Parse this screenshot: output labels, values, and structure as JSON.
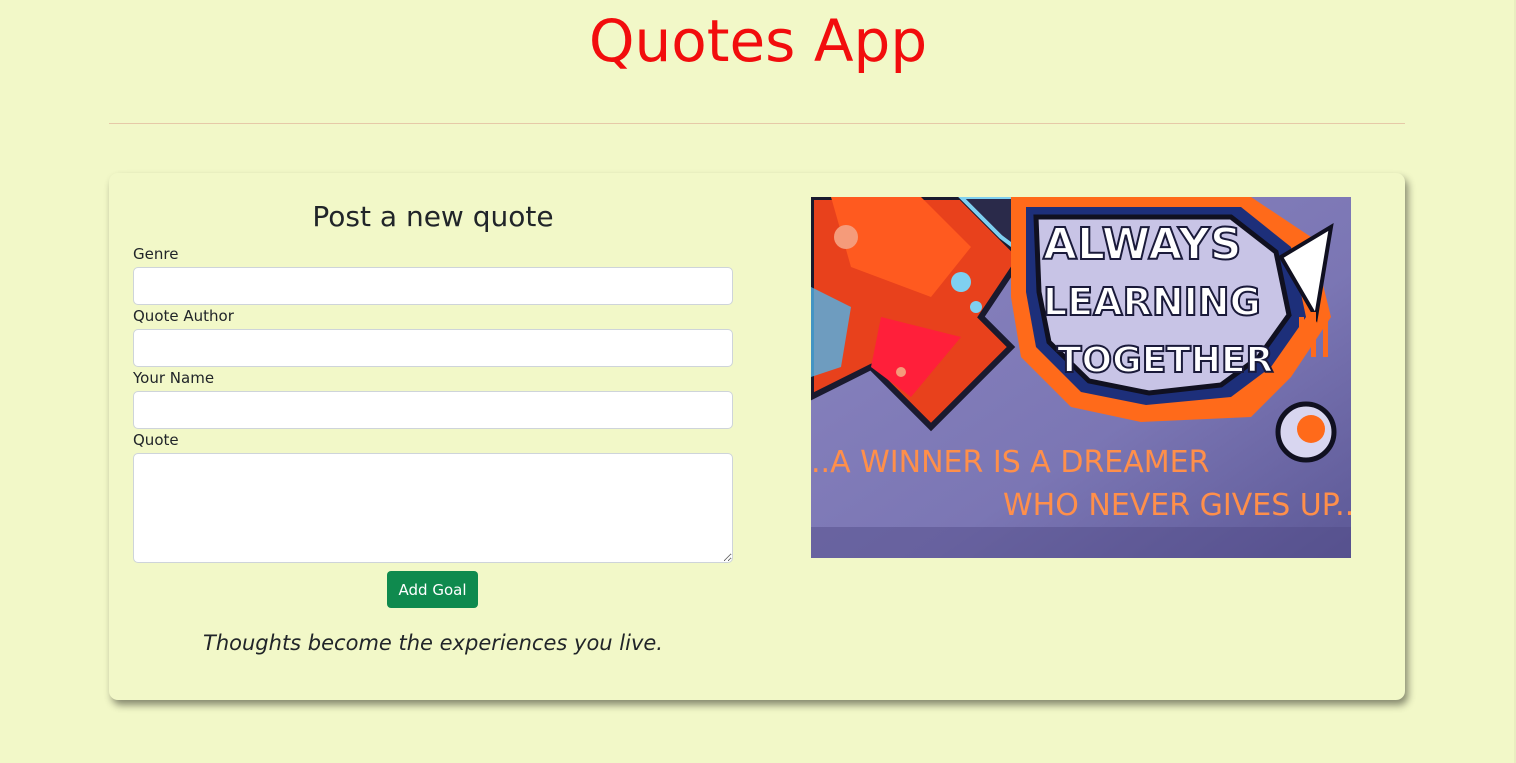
{
  "header": {
    "title": "Quotes App"
  },
  "form": {
    "heading": "Post a new quote",
    "fields": [
      {
        "label": "Genre",
        "value": ""
      },
      {
        "label": "Quote Author",
        "value": ""
      },
      {
        "label": "Your Name",
        "value": ""
      },
      {
        "label": "Quote",
        "value": ""
      }
    ],
    "submit_label": "Add Goal"
  },
  "motto": "Thoughts become the experiences you live.",
  "artwork": {
    "line1": "ALWAYS",
    "line2": "LEARNING",
    "line3": "TOGETHER",
    "slogan1": "..A WINNER IS A DREAMER",
    "slogan2": "WHO NEVER GIVES UP.."
  },
  "colors": {
    "background": "#f2f8c8",
    "title": "#f20d0d",
    "button": "#0f8a4e"
  }
}
